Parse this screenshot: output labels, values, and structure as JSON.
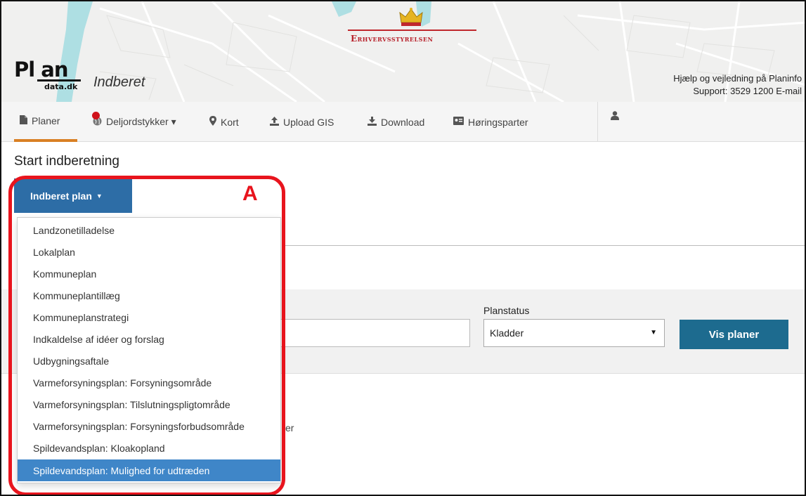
{
  "header": {
    "agency": "Erhvervsstyrelsen",
    "logo": {
      "top": "Pl  an",
      "sub": "data.dk"
    },
    "app_title": "Indberet",
    "help_text": "Hjælp og vejledning på Planinfo ›",
    "support_text": "Support: 3529 1200   E-mail ›"
  },
  "nav": {
    "items": [
      {
        "label": "Planer",
        "icon": "document-icon"
      },
      {
        "label": "Deljordstykker ▾",
        "icon": "globe-icon"
      },
      {
        "label": "Kort",
        "icon": "map-marker-icon"
      },
      {
        "label": "Upload GIS",
        "icon": "upload-icon"
      },
      {
        "label": "Download",
        "icon": "download-icon"
      },
      {
        "label": "Høringsparter",
        "icon": "contact-card-icon"
      }
    ],
    "user_icon": "user-icon"
  },
  "main": {
    "title": "Start indberetning",
    "dropdown_button": "Indberet plan",
    "menu": [
      "Landzonetilladelse",
      "Lokalplan",
      "Kommuneplan",
      "Kommuneplantillæg",
      "Kommuneplanstrategi",
      "Indkaldelse af idéer og forslag",
      "Udbygningsaftale",
      "Varmeforsyningsplan: Forsyningsområde",
      "Varmeforsyningsplan: Tilslutningspligtområde",
      "Varmeforsyningsplan: Forsyningsforbudsområde",
      "Spildevandsplan: Kloakopland",
      "Spildevandsplan: Mulighed for udtræden"
    ],
    "selected_index": 11,
    "peek_text": "er"
  },
  "filter": {
    "search_value": "",
    "planstatus_label": "Planstatus",
    "planstatus_value": "Kladder",
    "submit_label": "Vis planer"
  },
  "annotation": {
    "letter": "A",
    "color": "#e8141d"
  },
  "colors": {
    "brand_red": "#b8212b",
    "nav_active": "#d98024",
    "dropdown_blue": "#2d6da6",
    "selected_blue": "#3f86c8",
    "submit_teal": "#1d6b8f"
  }
}
